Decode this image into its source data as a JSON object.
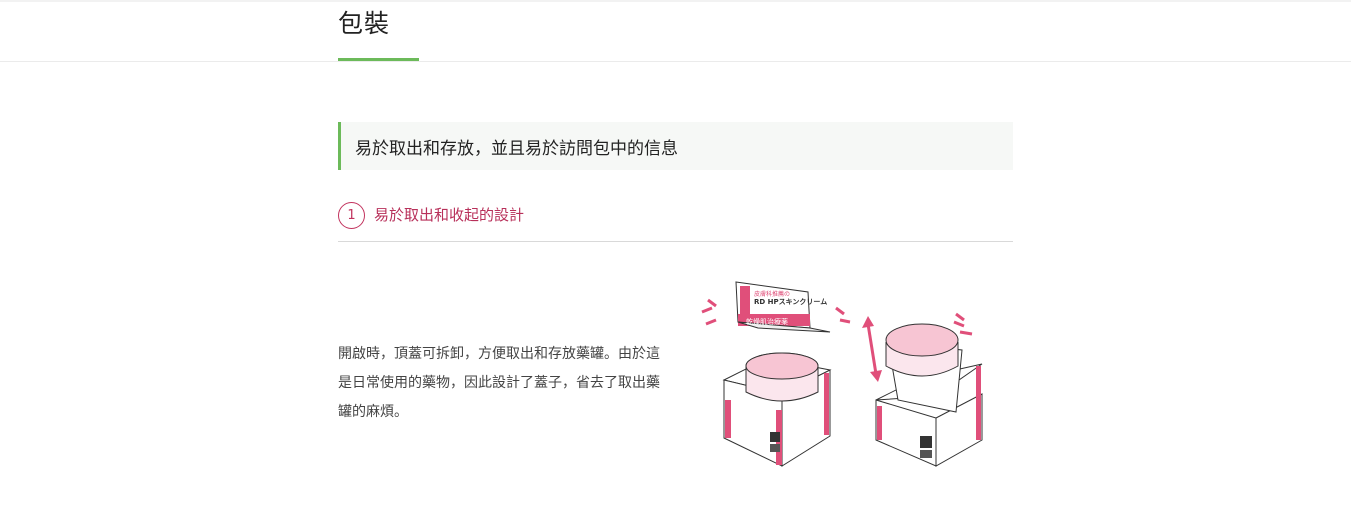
{
  "header": {
    "title": "包裝"
  },
  "banner": {
    "text": "易於取出和存放，並且易於訪問包中的信息"
  },
  "point": {
    "number": "1",
    "label": "易於取出和收起的設計"
  },
  "description": "開啟時，頂蓋可拆卸，方便取出和存放藥罐。由於這是日常使用的藥物，因此設計了蓋子，省去了取出藥罐的麻煩。",
  "illustration": {
    "lid_lines": [
      "皮膚科推薦の",
      "RD HPスキンクリーム",
      "乾燥肌治療薬"
    ],
    "accent_color": "#e04f7a",
    "jar_color": "#f7c5d3"
  }
}
